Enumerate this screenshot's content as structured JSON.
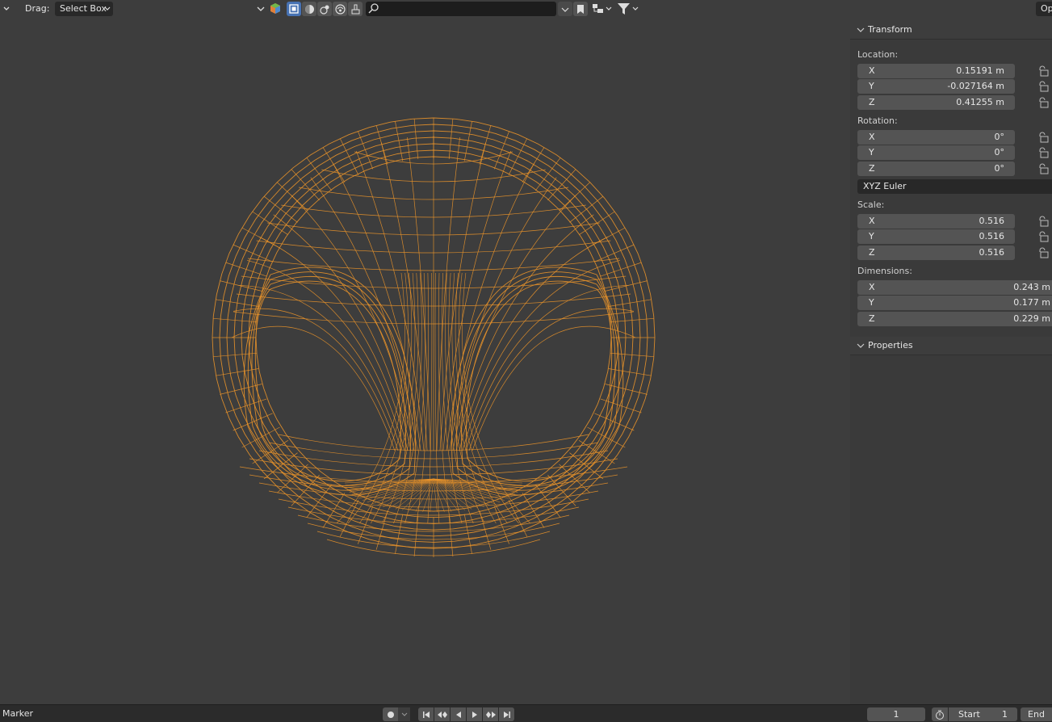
{
  "header": {
    "mode_dropdown_label": "",
    "drag_label": "Drag:",
    "drag_value": "Select Box",
    "search_placeholder": "",
    "options_label": "Op",
    "icons": [
      "chevron-down-icon",
      "object-type-icon",
      "solid-shading-icon",
      "material-shading-icon",
      "render-shading-icon",
      "overlay-icon",
      "paint-icon",
      "search-icon",
      "bookmark-icon",
      "filter-icon"
    ]
  },
  "sidebar": {
    "transform": {
      "title": "Transform",
      "location_label": "Location:",
      "location": [
        {
          "axis": "X",
          "value": "0.15191 m"
        },
        {
          "axis": "Y",
          "value": "-0.027164 m"
        },
        {
          "axis": "Z",
          "value": "0.41255 m"
        }
      ],
      "rotation_label": "Rotation:",
      "rotation": [
        {
          "axis": "X",
          "value": "0°"
        },
        {
          "axis": "Y",
          "value": "0°"
        },
        {
          "axis": "Z",
          "value": "0°"
        }
      ],
      "rotation_mode": "XYZ Euler",
      "scale_label": "Scale:",
      "scale": [
        {
          "axis": "X",
          "value": "0.516"
        },
        {
          "axis": "Y",
          "value": "0.516"
        },
        {
          "axis": "Z",
          "value": "0.516"
        }
      ],
      "dimensions_label": "Dimensions:",
      "dimensions": [
        {
          "axis": "X",
          "value": "0.243 m"
        },
        {
          "axis": "Y",
          "value": "0.177 m"
        },
        {
          "axis": "Z",
          "value": "0.229 m"
        }
      ]
    },
    "properties": {
      "title": "Properties"
    }
  },
  "timeline": {
    "marker_label": "Marker",
    "current_frame": "1",
    "start_label": "Start",
    "start_value": "1",
    "end_label": "End"
  },
  "colors": {
    "background": "#3d3d3d",
    "wireframe": "#e8922a",
    "accent": "#4772b3"
  }
}
